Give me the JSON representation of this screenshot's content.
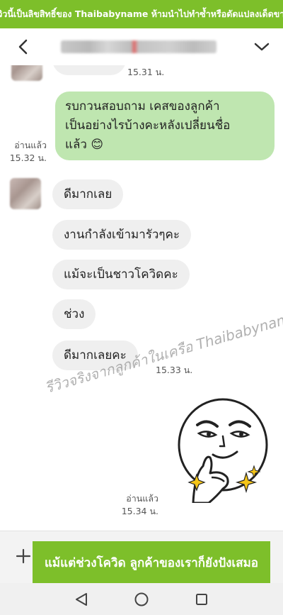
{
  "banner": {
    "text": "รีวิวนี้เป็นลิขสิทธิ์ของ Thaibabyname ห้ามนำไปทำซ้ำหรือดัดแปลงเด็ดขาด"
  },
  "header": {
    "back_icon": "chevron-left-icon",
    "title": "●●●● ●●● ●●●●●",
    "menu_icon": "chevron-down-icon"
  },
  "messages": {
    "top_time": "15.31 น.",
    "out1": {
      "lines": [
        "รบกวนสอบถาม เคสของลูกค้า",
        "เป็นอย่างไรบ้างคะหลังเปลี่ยนชื่อ",
        "แล้ว 😊"
      ],
      "read": "อ่านแล้ว",
      "time": "15.32 น."
    },
    "in_msgs": [
      "ดีมากเลย",
      "งานกำลังเข้ามารัวๆคะ",
      "แม้จะเป็นชาวโควิดคะ",
      "ช่วง",
      "ดีมากเลยคะ"
    ],
    "in_time": "15.33 น.",
    "sticker": {
      "icon": "smug-thumbs-up-sticker",
      "read": "อ่านแล้ว",
      "time": "15.34 น."
    }
  },
  "watermark": "รีวิวจริงจากลูกค้าในเครือ Thaibabyname",
  "input_bar": {
    "plus_icon": "plus-icon",
    "promo": "แม้แต่ช่วงโควิด ลูกค้าของเราก็ยังปังเสมอ"
  },
  "nav": {
    "back": "triangle-back-icon",
    "home": "circle-home-icon",
    "recents": "square-recents-icon"
  }
}
